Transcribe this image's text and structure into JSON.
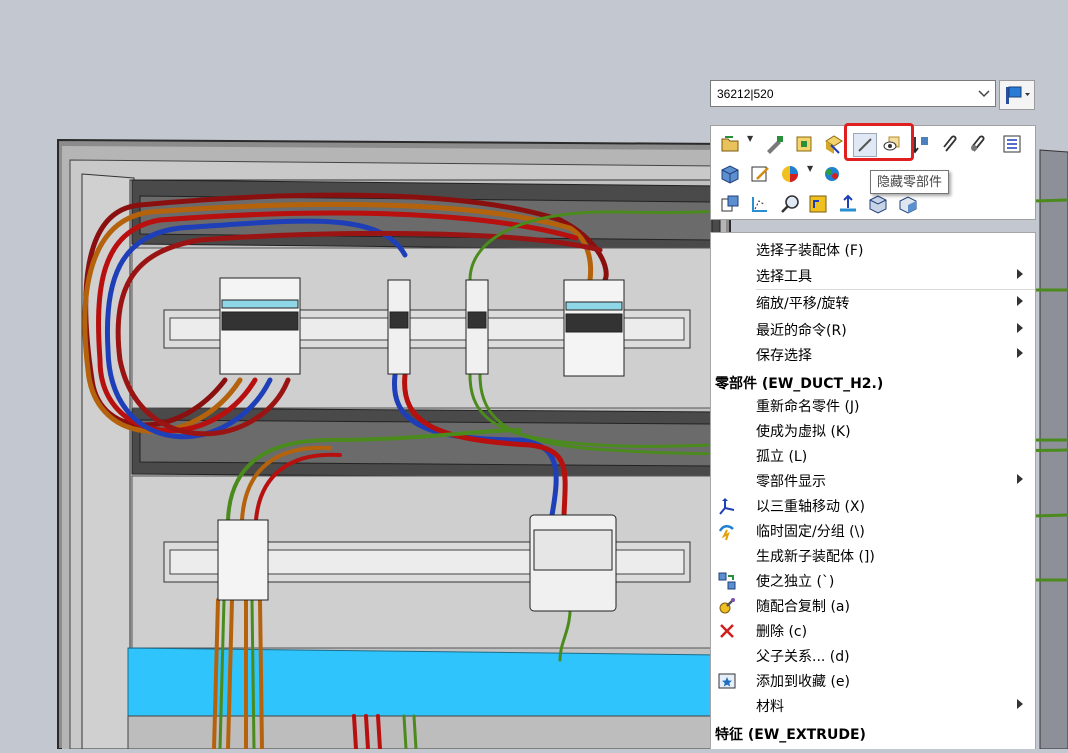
{
  "config_combo": {
    "value": "36212|520"
  },
  "toolbar": {
    "tooltip": "隐藏零部件"
  },
  "context_menu": {
    "items_top": [
      {
        "label": "选择子装配体 (F)",
        "submenu": false
      },
      {
        "label": "选择工具",
        "submenu": true
      },
      {
        "label": "缩放/平移/旋转",
        "submenu": true
      },
      {
        "label": "最近的命令(R)",
        "submenu": true
      },
      {
        "label": "保存选择",
        "submenu": true
      }
    ],
    "section_part": "零部件 (EW_DUCT_H2.)",
    "items_part": [
      {
        "label": "重新命名零件 (J)",
        "icon": ""
      },
      {
        "label": "使成为虚拟 (K)",
        "icon": ""
      },
      {
        "label": "孤立 (L)",
        "icon": ""
      },
      {
        "label": "零部件显示",
        "icon": "",
        "submenu": true
      },
      {
        "label": "以三重轴移动 (X)",
        "icon": "triad-icon"
      },
      {
        "label": "临时固定/分组 (\\)",
        "icon": "temp-fix-icon"
      },
      {
        "label": "生成新子装配体 (])",
        "icon": ""
      },
      {
        "label": "使之独立 (`)",
        "icon": "make-independent-icon"
      },
      {
        "label": "随配合复制 (a)",
        "icon": "copy-with-mates-icon"
      },
      {
        "label": "删除 (c)",
        "icon": "delete-icon"
      },
      {
        "label": "父子关系... (d)",
        "icon": ""
      },
      {
        "label": "添加到收藏 (e)",
        "icon": "favorite-icon"
      },
      {
        "label": "材料",
        "icon": "",
        "submenu": true
      }
    ],
    "section_feature": "特征 (EW_EXTRUDE)"
  },
  "colors": {
    "viewport_bg": "#c3c7cf",
    "panel": "#bcbcbc",
    "duct": "#2fc4fb",
    "wire_red": "#b80f0f",
    "wire_orange": "#b5620c",
    "wire_blue": "#1f3fb8",
    "wire_green": "#4b8a1c",
    "highlight": "#e02020"
  }
}
